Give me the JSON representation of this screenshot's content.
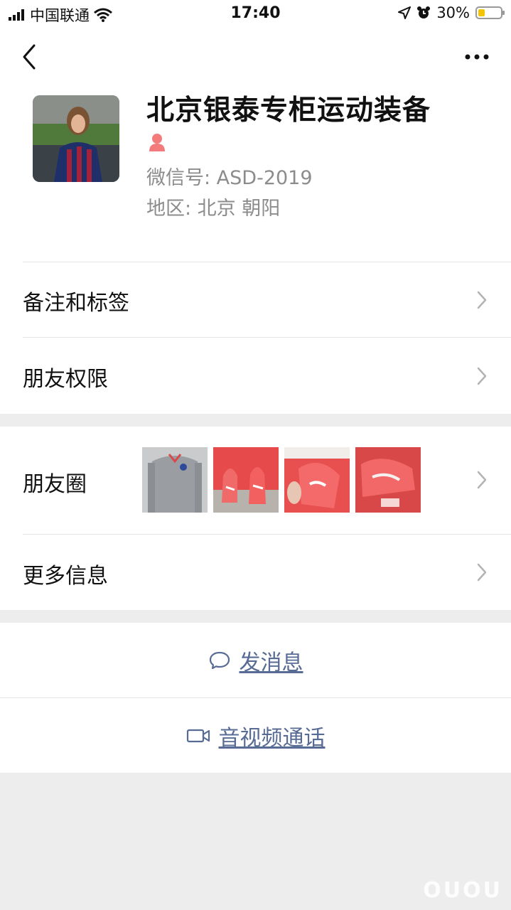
{
  "status_bar": {
    "carrier": "中国联通",
    "time": "17:40",
    "battery_percent": "30%",
    "battery_level": 0.3
  },
  "nav": {
    "back_icon": "back-chevron-icon",
    "more_icon": "more-dots-icon"
  },
  "profile": {
    "name": "北京银泰专柜运动装备",
    "gender_icon": "female-user-icon",
    "wechat_id": "微信号: ASD-2019",
    "region": "地区: 北京 朝阳"
  },
  "rows": {
    "remarks": "备注和标签",
    "permissions": "朋友权限",
    "moments": "朋友圈",
    "more_info": "更多信息"
  },
  "actions": {
    "message": "发消息",
    "av_call": "音视频通话"
  },
  "watermark": "OUOU",
  "colors": {
    "link": "#576b95",
    "background": "#ededed",
    "gender": "#f37b7b",
    "battery": "#f5c400"
  }
}
